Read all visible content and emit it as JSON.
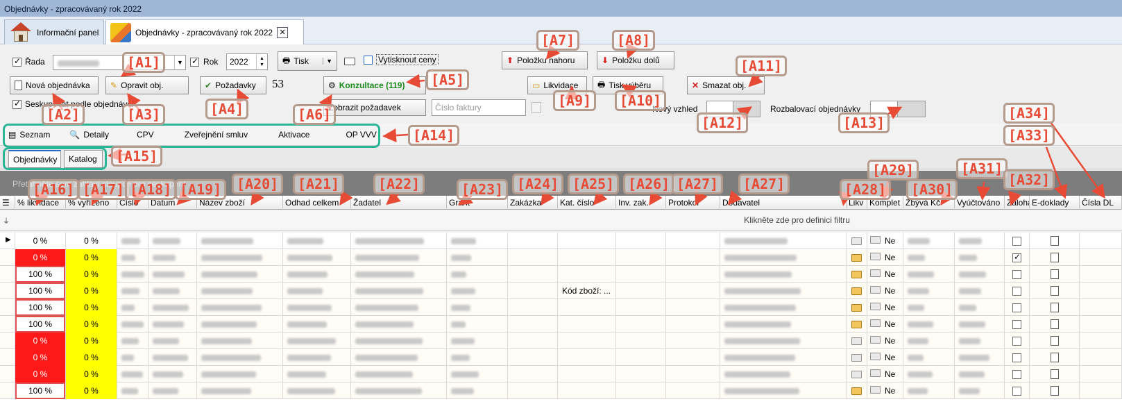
{
  "window": {
    "title": "Objednávky - zpracovávaný rok 2022"
  },
  "doc_tabs": [
    {
      "label": "Informační panel",
      "icon": "home-icon"
    },
    {
      "label": "Objednávky - zpracovávaný rok 2022",
      "icon": "orders-icon"
    }
  ],
  "toolbar": {
    "rada_label": "Řada",
    "rok_label": "Rok",
    "rok_value": "2022",
    "tisk_label": "Tisk",
    "vytisknout_ceny_label": "Vytisknout ceny",
    "polozku_nahoru": "Položku nahoru",
    "polozku_dolu": "Položku dolů",
    "nova_objednavka": "Nová objednávka",
    "opravit_obj": "Opravit obj.",
    "pozadavky": "Požadavky",
    "pozadavky_count": "53",
    "konzultace": "Konzultace (119)",
    "likvidace": "Likvidace",
    "tisk_vyberu": "Tisk výběru",
    "smazat_obj": "Smazat obj.",
    "seskupovat_label": "Seskupovat podle objednávek",
    "zobrazit_pozadavek": "Zobrazit požadavek",
    "cislo_faktury_placeholder": "Číslo faktury",
    "novy_vzhled_label": "Nový vzhled",
    "rozbalovaci_label": "Rozbalovací objednávky"
  },
  "view_tabs": [
    "Seznam",
    "Detaily",
    "CPV",
    "Zveřejnění smluv",
    "Aktivace",
    "OP VVV"
  ],
  "sub_tabs": [
    "Objednávky",
    "Katalog"
  ],
  "group_hint": "Přetáhněte sem záhlaví sloupce pro seskupení",
  "columns": [
    "% likvidace",
    "% vyřízeno",
    "Číslo",
    "Datum",
    "Název zboží",
    "Odhad celkem",
    "Žadatel",
    "Grant",
    "Zakázka",
    "Kat. číslo",
    "Inv. zak.",
    "Protokol",
    "Dodavatel",
    "Likv",
    "Komplet",
    "Zbývá Kč",
    "Vyúčtováno",
    "Záloha",
    "E-doklady",
    "Čísla DL"
  ],
  "filter_hint": "Klikněte zde pro definici filtru",
  "rows": [
    {
      "likv": "0 %",
      "vyr": "0 %",
      "likv_color": "white",
      "vyr_color": "white",
      "kat": "",
      "folder_orange": false,
      "komplet": "Ne",
      "zaloha": false
    },
    {
      "likv": "0 %",
      "vyr": "0 %",
      "likv_color": "red",
      "vyr_color": "yellow",
      "kat": "",
      "folder_orange": true,
      "komplet": "Ne",
      "zaloha": true
    },
    {
      "likv": "100 %",
      "vyr": "0 %",
      "likv_color": "white",
      "vyr_color": "yellow",
      "kat": "",
      "folder_orange": true,
      "komplet": "Ne",
      "zaloha": false
    },
    {
      "likv": "100 %",
      "vyr": "0 %",
      "likv_color": "white",
      "vyr_color": "yellow",
      "kat": "Kód zboží: ...",
      "folder_orange": true,
      "komplet": "Ne",
      "zaloha": false
    },
    {
      "likv": "100 %",
      "vyr": "0 %",
      "likv_color": "white",
      "vyr_color": "yellow",
      "kat": "",
      "folder_orange": true,
      "komplet": "Ne",
      "zaloha": false
    },
    {
      "likv": "100 %",
      "vyr": "0 %",
      "likv_color": "white",
      "vyr_color": "yellow",
      "kat": "",
      "folder_orange": true,
      "komplet": "Ne",
      "zaloha": false
    },
    {
      "likv": "0 %",
      "vyr": "0 %",
      "likv_color": "red",
      "vyr_color": "yellow",
      "kat": "",
      "folder_orange": false,
      "komplet": "Ne",
      "zaloha": false
    },
    {
      "likv": "0 %",
      "vyr": "0 %",
      "likv_color": "red",
      "vyr_color": "yellow",
      "kat": "",
      "folder_orange": false,
      "komplet": "Ne",
      "zaloha": false
    },
    {
      "likv": "0 %",
      "vyr": "0 %",
      "likv_color": "red",
      "vyr_color": "yellow",
      "kat": "",
      "folder_orange": false,
      "komplet": "Ne",
      "zaloha": false
    },
    {
      "likv": "100 %",
      "vyr": "0 %",
      "likv_color": "white",
      "vyr_color": "yellow",
      "kat": "",
      "folder_orange": true,
      "komplet": "Ne",
      "zaloha": false
    }
  ],
  "annotations": [
    "[A1]",
    "[A2]",
    "[A3]",
    "[A4]",
    "[A5]",
    "[A6]",
    "[A7]",
    "[A8]",
    "[A9]",
    "[A10]",
    "[A11]",
    "[A12]",
    "[A13]",
    "[A14]",
    "[A15]",
    "[A16]",
    "[A17]",
    "[A18]",
    "[A19]",
    "[A20]",
    "[A21]",
    "[A22]",
    "[A23]",
    "[A24]",
    "[A25]",
    "[A26]",
    "[A27]",
    "[A27]",
    "[A28]",
    "[A29]",
    "[A30]",
    "[A31]",
    "[A32]",
    "[A33]",
    "[A34]"
  ],
  "colors": {
    "red": "#ff1a1a",
    "yellow": "#ffff00",
    "annotation": "#e84b35",
    "highlight": "#2bb796"
  }
}
